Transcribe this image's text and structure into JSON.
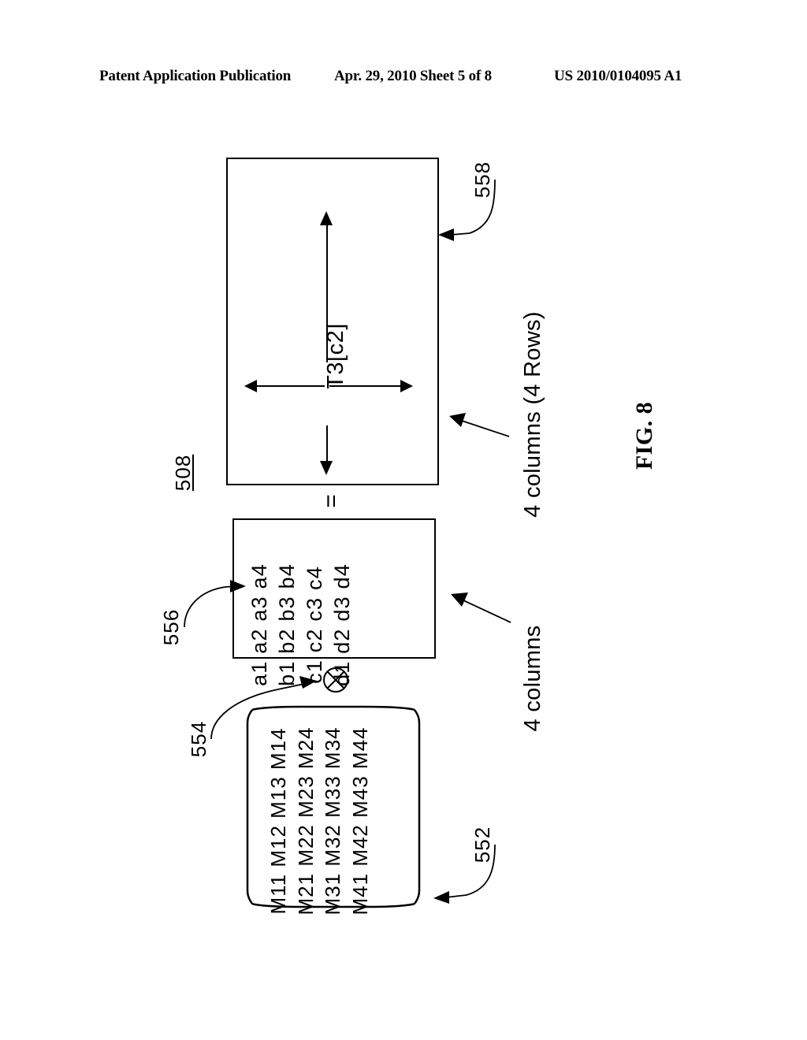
{
  "header": {
    "left": "Patent Application Publication",
    "center": "Apr. 29, 2010  Sheet 5 of 8",
    "right": "US 2010/0104095 A1"
  },
  "figure": {
    "caption": "FIG. 8",
    "result_box": {
      "ref": "508",
      "label": "T3[c2]",
      "pointer_ref": "558"
    },
    "operator": {
      "equals": "=",
      "multiply_symbol": "circled-times",
      "multiply_ref": "554"
    },
    "vector_matrix": {
      "ref": "556",
      "rows": [
        "a1 a2 a3 a4",
        "b1 b2 b3 b4",
        "c1 c2 c3 c4",
        "d1 d2 d3 d4"
      ]
    },
    "coefficient_matrix": {
      "ref": "552",
      "rows": [
        "M11 M12 M13 M14",
        "M21 M22 M23 M24",
        "M31 M32 M33 M34",
        "M41 M42 M43 M44"
      ]
    },
    "annotations": {
      "result_dimensions": "4 columns (4 Rows)",
      "vector_dimensions": "4  columns"
    }
  },
  "colors": {
    "ink": "#000000",
    "paper": "#ffffff"
  }
}
